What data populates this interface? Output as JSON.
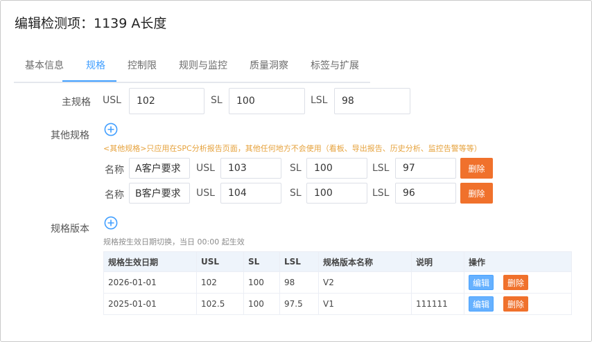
{
  "page": {
    "title": "编辑检测项：1139 A长度"
  },
  "tabs": [
    {
      "label": "基本信息"
    },
    {
      "label": "规格"
    },
    {
      "label": "控制限"
    },
    {
      "label": "规则与监控"
    },
    {
      "label": "质量洞察"
    },
    {
      "label": "标签与扩展"
    }
  ],
  "active_tab": "规格",
  "main_spec": {
    "label": "主规格",
    "usl_label": "USL",
    "usl_value": "102",
    "sl_label": "SL",
    "sl_value": "100",
    "lsl_label": "LSL",
    "lsl_value": "98"
  },
  "other_specs": {
    "label": "其他规格",
    "note": "<其他规格>只应用在SPC分析报告页面，其他任何地方不会使用（看板、导出报告、历史分析、监控告警等等）",
    "name_label": "名称",
    "usl_label": "USL",
    "sl_label": "SL",
    "lsl_label": "LSL",
    "delete_label": "删除",
    "items": [
      {
        "name": "A客户要求",
        "usl": "103",
        "sl": "100",
        "lsl": "97"
      },
      {
        "name": "B客户要求",
        "usl": "104",
        "sl": "100",
        "lsl": "96"
      }
    ]
  },
  "spec_versions": {
    "label": "规格版本",
    "note": "规格按生效日期切换，当日 00:00 起生效",
    "columns": [
      "规格生效日期",
      "USL",
      "SL",
      "LSL",
      "规格版本名称",
      "说明",
      "操作"
    ],
    "edit_label": "编辑",
    "delete_label": "删除",
    "rows": [
      {
        "date": "2026-01-01",
        "usl": "102",
        "sl": "100",
        "lsl": "98",
        "name": "V2",
        "desc": ""
      },
      {
        "date": "2025-01-01",
        "usl": "102.5",
        "sl": "100",
        "lsl": "97.5",
        "name": "V1",
        "desc": "111111"
      }
    ]
  },
  "colors": {
    "accent": "#409eff",
    "danger": "#f0712c",
    "warning": "#e6a23c",
    "header_bg": "#eef4fb"
  }
}
